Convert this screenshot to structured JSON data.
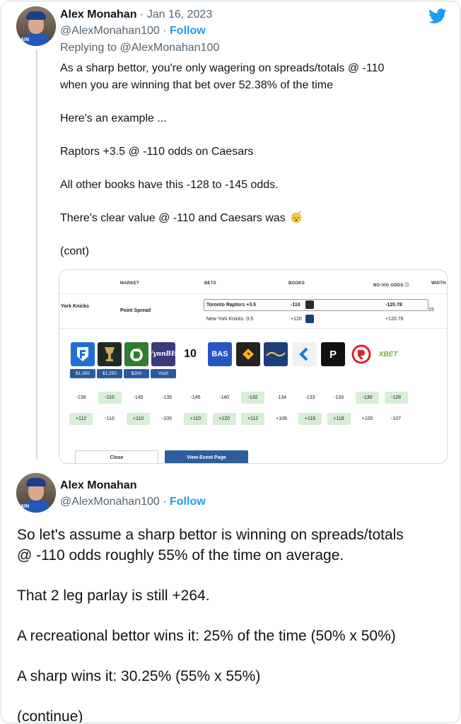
{
  "tweet1": {
    "author_name": "Alex Monahan",
    "separator": "·",
    "date": "Jan 16, 2023",
    "handle": "@AlexMonahan100",
    "follow_label": "Follow",
    "reply_to": "Replying to @AlexMonahan100",
    "paragraphs": [
      "As a sharp bettor, you're only wagering on spreads/totals @ -110\nwhen you are winning that bet over 52.38% of the time",
      "Here's an example ...",
      "Raptors +3.5 @ -110 odds on Caesars",
      "All other books have this -128 to -145 odds.",
      "There's clear value @ -110 and Caesars was",
      "(cont)"
    ],
    "emoji": "sleeping-face-icon"
  },
  "card": {
    "headers": {
      "market": "MARKET",
      "bets": "BETS",
      "books": "BOOKS",
      "novig": "NO-VIG ODDS ⓘ",
      "width": "WIDTH"
    },
    "event": "York Knicks",
    "market_type": "Point Spread",
    "bets": [
      {
        "name": "Toronto Raptors +3.5",
        "odds": "-110",
        "novig": "-120.78"
      },
      {
        "name": "New York Knicks -3.5",
        "odds": "+120",
        "novig": "+120.78"
      }
    ],
    "width_value": "15",
    "books": [
      {
        "icon": "fanduel-icon",
        "label": "",
        "color": "#1f6fd1",
        "bonus": "$1,000"
      },
      {
        "icon": "caesars-icon",
        "label": "",
        "color": "#1f2a24",
        "bonus": "$1,250"
      },
      {
        "icon": "draftkings-icon",
        "label": "",
        "color": "#2f7d32",
        "bonus": "$200"
      },
      {
        "icon": "wynnbet-icon",
        "label": "WynnBET",
        "color": "#3b3a7c",
        "bonus": "Visit!"
      },
      {
        "icon": "pointsbet-icon",
        "label": "",
        "color": "#ffffff",
        "bonus": ""
      },
      {
        "icon": "bas-icon",
        "label": "BAS",
        "color": "#2856c5",
        "bonus": ""
      },
      {
        "icon": "betfair-icon",
        "label": "betfair",
        "color": "#222222",
        "bonus": ""
      },
      {
        "icon": "betrivers-icon",
        "label": "",
        "color": "#1c3f7a",
        "bonus": ""
      },
      {
        "icon": "unibet-icon",
        "label": "",
        "color": "#f0f3f6",
        "bonus": ""
      },
      {
        "icon": "pointsbet-p-icon",
        "label": "P",
        "color": "#111111",
        "bonus": ""
      },
      {
        "icon": "resorts-world-icon",
        "label": "",
        "color": "#ffffff",
        "bonus": ""
      },
      {
        "icon": "xbet-icon",
        "label": "XBET",
        "color": "#ffffff",
        "bonus": ""
      }
    ],
    "odds_row1": [
      {
        "v": "-138",
        "hl": false
      },
      {
        "v": "-110",
        "hl": true
      },
      {
        "v": "-145",
        "hl": false
      },
      {
        "v": "-135",
        "hl": false
      },
      {
        "v": "-145",
        "hl": false
      },
      {
        "v": "-140",
        "hl": false
      },
      {
        "v": "-132",
        "hl": true
      },
      {
        "v": "-134",
        "hl": false
      },
      {
        "v": "-133",
        "hl": false
      },
      {
        "v": "-133",
        "hl": false
      },
      {
        "v": "-130",
        "hl": true
      },
      {
        "v": "-128",
        "hl": true
      }
    ],
    "odds_row2": [
      {
        "v": "+112",
        "hl": true
      },
      {
        "v": "-110",
        "hl": false
      },
      {
        "v": "+110",
        "hl": true
      },
      {
        "v": "-105",
        "hl": false
      },
      {
        "v": "+110",
        "hl": true
      },
      {
        "v": "+120",
        "hl": true
      },
      {
        "v": "+112",
        "hl": true
      },
      {
        "v": "+106",
        "hl": false
      },
      {
        "v": "+118",
        "hl": true
      },
      {
        "v": "+118",
        "hl": true
      },
      {
        "v": "+100",
        "hl": false
      },
      {
        "v": "-107",
        "hl": false
      }
    ],
    "close_label": "Close",
    "event_label": "View Event Page"
  },
  "tweet2": {
    "author_name": "Alex Monahan",
    "handle": "@AlexMonahan100",
    "separator": "·",
    "follow_label": "Follow",
    "paragraphs": [
      "So let's assume a sharp bettor is winning on spreads/totals\n@ -110 odds roughly 55% of the time on average.",
      "That 2 leg parlay is still +264.",
      "A recreational bettor wins it: 25% of the time (50% x 50%)",
      "A sharp wins it: 30.25% (55% x 55%)",
      "(continue)"
    ]
  },
  "colors": {
    "twitter_blue": "#1d9bf0",
    "muted": "#536471",
    "highlight_green": "#d7efd7",
    "button_blue": "#2c5e9c"
  }
}
